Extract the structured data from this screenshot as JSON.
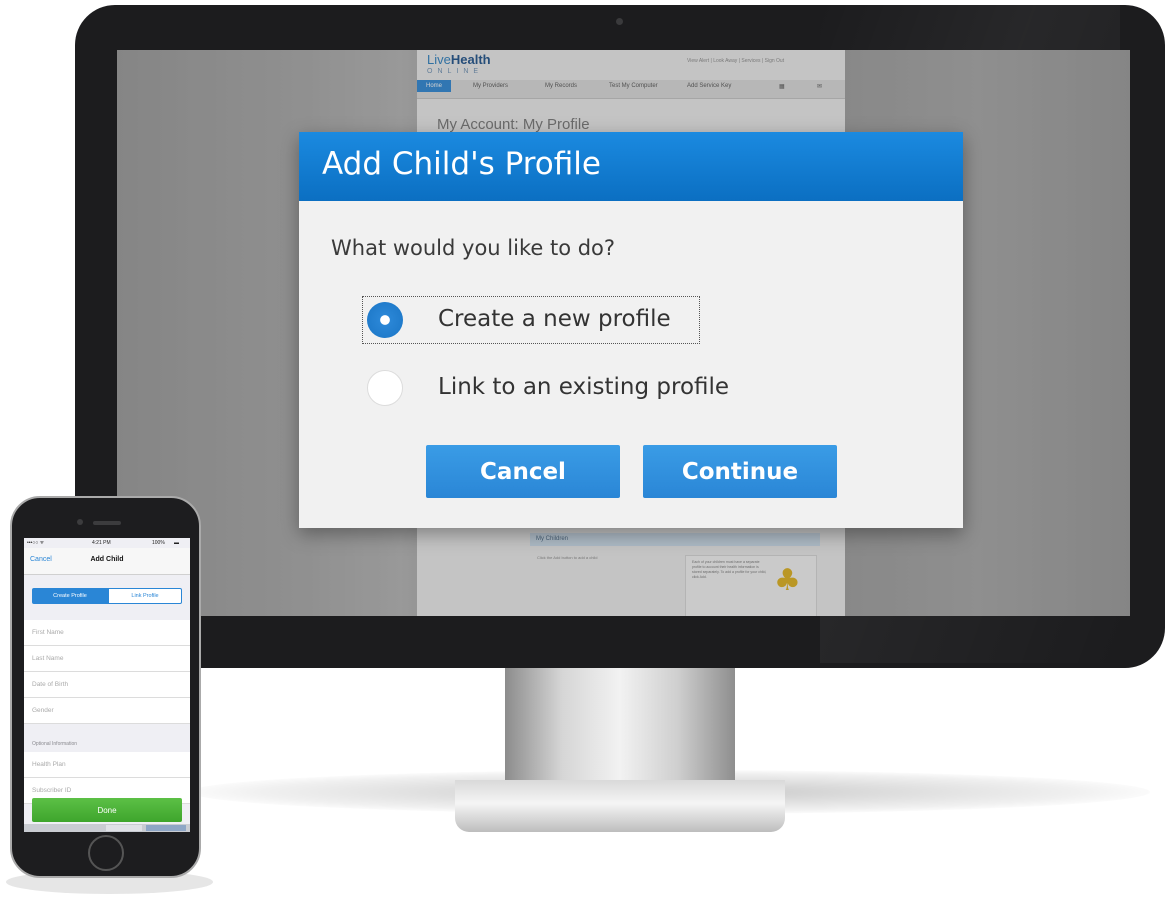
{
  "desktop": {
    "site": {
      "logo_main": "Live",
      "logo_bold": "Health",
      "logo_sub": "ONLINE",
      "top_links": "View Alert | Look Away | Services | Sign Out",
      "nav": [
        {
          "label": "Home"
        },
        {
          "label": "My Providers"
        },
        {
          "label": "My Records"
        },
        {
          "label": "Test My Computer"
        },
        {
          "label": "Add Service Key"
        }
      ],
      "heading": "My Account: My Profile",
      "my_children": "My Children",
      "children_hint": "Click the Add button to add a child",
      "promo_text": "Each of your children must have a separate profile to account their health information is stored separately. To add a profile for your child, click Add."
    },
    "dialog": {
      "title": "Add Child's Profile",
      "question": "What would you like to do?",
      "options": [
        {
          "label": "Create a new profile",
          "selected": true
        },
        {
          "label": "Link to an existing profile",
          "selected": false
        }
      ],
      "cancel_label": "Cancel",
      "continue_label": "Continue",
      "accent_color": "#2a86d6"
    }
  },
  "phone": {
    "status": {
      "carrier": "•••○○ ᯤ",
      "time": "4:21 PM",
      "battery": "100%"
    },
    "nav": {
      "cancel_label": "Cancel",
      "title": "Add Child"
    },
    "segments": {
      "create_label": "Create Profile",
      "link_label": "Link Profile"
    },
    "fields": {
      "first_name": "First Name",
      "last_name": "Last Name",
      "dob": "Date of Birth",
      "gender": "Gender",
      "optional_header": "Optional Information",
      "health_plan": "Health Plan",
      "subscriber_id": "Subscriber ID"
    },
    "done_label": "Done",
    "done_color": "#44aa33"
  }
}
